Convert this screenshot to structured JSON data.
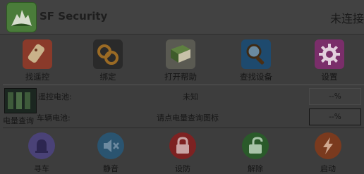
{
  "app": {
    "title": "SF Security",
    "status": "未连接"
  },
  "toolbar": [
    {
      "label": "找遥控",
      "icon": "remote-search-icon",
      "color": "#9a3f2e"
    },
    {
      "label": "绑定",
      "icon": "chain-link-icon",
      "color": "#6e4b1a"
    },
    {
      "label": "打开帮助",
      "icon": "help-book-icon",
      "color": "#4f6a38"
    },
    {
      "label": "查找设备",
      "icon": "magnifier-icon",
      "color": "#2f5575"
    },
    {
      "label": "设置",
      "icon": "gear-icon",
      "color": "#7b2f6c"
    }
  ],
  "battery": {
    "icon_label": "电量查询",
    "remote_label": "遥控电池:",
    "remote_value": "未知",
    "remote_pct": "--%",
    "vehicle_label": "车辆电池:",
    "vehicle_value": "请点电量查询图标",
    "vehicle_pct": "--%"
  },
  "actions": [
    {
      "label": "寻车",
      "icon": "bell-icon",
      "color": "#4d4478"
    },
    {
      "label": "静音",
      "icon": "mute-icon",
      "color": "#2e5671"
    },
    {
      "label": "设防",
      "icon": "lock-icon",
      "color": "#7e2323"
    },
    {
      "label": "解除",
      "icon": "unlock-icon",
      "color": "#2b5a2b"
    },
    {
      "label": "启动",
      "icon": "lightning-icon",
      "color": "#7a3a1e"
    }
  ]
}
